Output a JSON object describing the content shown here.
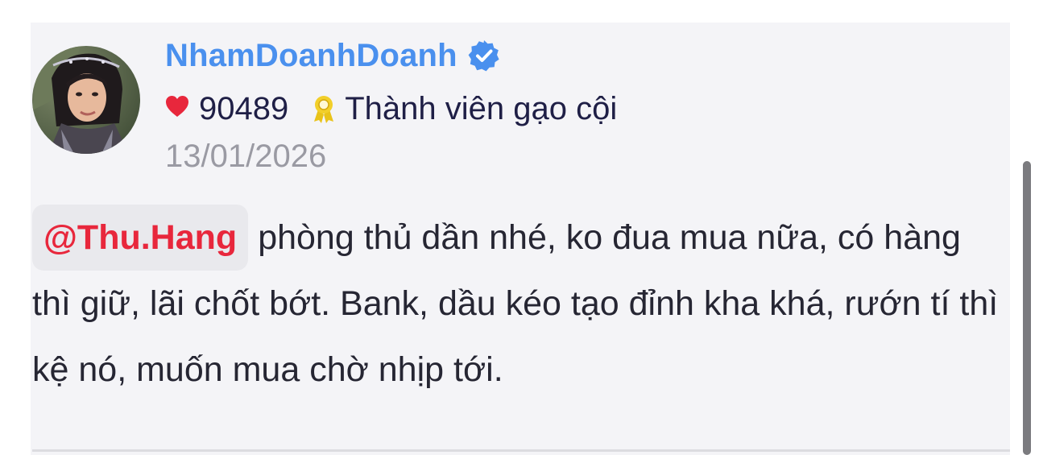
{
  "post": {
    "author": {
      "username": "NhamDoanhDoanh",
      "verified": true,
      "avatar": "avatar-image",
      "likes": "90489",
      "rank": "Thành viên gạo cội"
    },
    "date": "13/01/2026",
    "mention": "@Thu.Hang",
    "body": "phòng thủ dần nhé, ko đua mua nữa, có hàng thì giữ, lãi chốt bớt. Bank, dầu kéo tạo đỉnh kha khá, rướn tí thì kệ nó, muốn mua chờ nhịp tới."
  },
  "icons": {
    "verified": "verified-check-icon",
    "heart": "heart-icon",
    "rank": "award-ribbon-icon"
  },
  "colors": {
    "username": "#4a90ee",
    "mention": "#e8273c",
    "heart": "#e8273c",
    "rank_icon": "#e9c31a",
    "date": "#9a9aa3",
    "text": "#262633",
    "card_background": "#f4f4f7"
  }
}
